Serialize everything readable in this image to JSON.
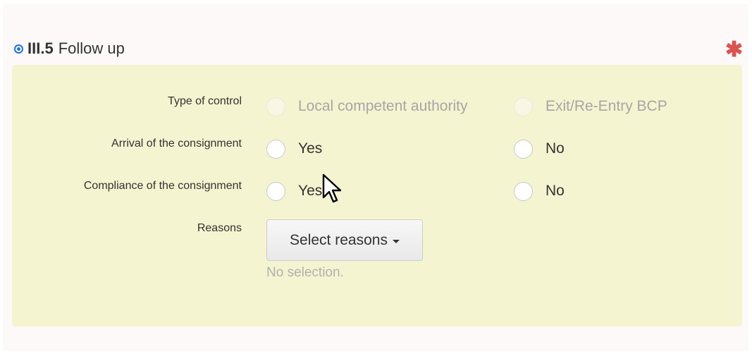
{
  "section": {
    "code": "III.5",
    "title": "Follow up",
    "required_mark": "✱"
  },
  "rows": {
    "type_of_control": {
      "label": "Type of control",
      "options": [
        "Local competent authority",
        "Exit/Re-Entry BCP"
      ]
    },
    "arrival": {
      "label": "Arrival of the consignment",
      "options": [
        "Yes",
        "No"
      ]
    },
    "compliance": {
      "label": "Compliance of the consignment",
      "options": [
        "Yes",
        "No"
      ]
    },
    "reasons": {
      "label": "Reasons",
      "button_label": "Select reasons",
      "selection_text": "No selection."
    }
  },
  "colors": {
    "panel_background": "#f5f4d0",
    "accent": "#1a73e8",
    "required": "#d9534f"
  },
  "icons": {
    "header_radio": "radio-selected-icon",
    "required": "asterisk-icon",
    "dropdown": "caret-down-icon",
    "cursor": "mouse-pointer-icon"
  }
}
